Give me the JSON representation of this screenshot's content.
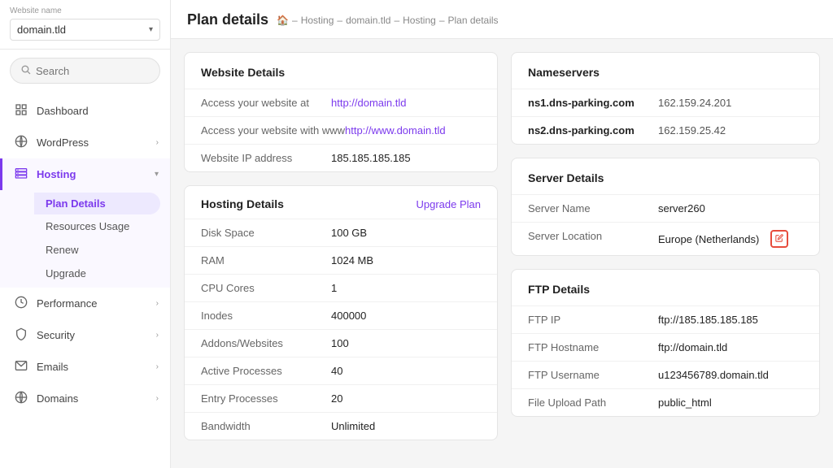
{
  "sidebar": {
    "website_name_label": "Website name",
    "website_name_value": "domain.tld",
    "search_placeholder": "Search",
    "nav_items": [
      {
        "id": "dashboard",
        "label": "Dashboard",
        "icon": "grid",
        "expanded": false
      },
      {
        "id": "wordpress",
        "label": "WordPress",
        "icon": "wp",
        "expanded": false
      },
      {
        "id": "hosting",
        "label": "Hosting",
        "icon": "hosting",
        "expanded": true,
        "sub_items": [
          {
            "id": "plan-details",
            "label": "Plan Details",
            "active": true
          },
          {
            "id": "resources-usage",
            "label": "Resources Usage",
            "active": false
          },
          {
            "id": "renew",
            "label": "Renew",
            "active": false
          },
          {
            "id": "upgrade",
            "label": "Upgrade",
            "active": false
          }
        ]
      },
      {
        "id": "performance",
        "label": "Performance",
        "icon": "performance",
        "expanded": false
      },
      {
        "id": "security",
        "label": "Security",
        "icon": "security",
        "expanded": false
      },
      {
        "id": "emails",
        "label": "Emails",
        "icon": "emails",
        "expanded": false
      },
      {
        "id": "domains",
        "label": "Domains",
        "icon": "domains",
        "expanded": false
      }
    ]
  },
  "page": {
    "title": "Plan details",
    "breadcrumb": [
      {
        "label": "🏠"
      },
      {
        "label": "Hosting"
      },
      {
        "label": "domain.tld"
      },
      {
        "label": "Hosting"
      },
      {
        "label": "Plan details"
      }
    ]
  },
  "website_details": {
    "section_title": "Website Details",
    "rows": [
      {
        "label": "Access your website at",
        "value": "http://domain.tld",
        "is_link": true
      },
      {
        "label": "Access your website with www",
        "value": "http://www.domain.tld",
        "is_link": true
      },
      {
        "label": "Website IP address",
        "value": "185.185.185.185",
        "is_link": false
      }
    ]
  },
  "hosting_details": {
    "section_title": "Hosting Details",
    "upgrade_label": "Upgrade Plan",
    "rows": [
      {
        "label": "Disk Space",
        "value": "100 GB"
      },
      {
        "label": "RAM",
        "value": "1024 MB"
      },
      {
        "label": "CPU Cores",
        "value": "1"
      },
      {
        "label": "Inodes",
        "value": "400000"
      },
      {
        "label": "Addons/Websites",
        "value": "100"
      },
      {
        "label": "Active Processes",
        "value": "40"
      },
      {
        "label": "Entry Processes",
        "value": "20"
      },
      {
        "label": "Bandwidth",
        "value": "Unlimited"
      }
    ]
  },
  "nameservers": {
    "section_title": "Nameservers",
    "rows": [
      {
        "label": "ns1.dns-parking.com",
        "value": "162.159.24.201"
      },
      {
        "label": "ns2.dns-parking.com",
        "value": "162.159.25.42"
      }
    ]
  },
  "server_details": {
    "section_title": "Server Details",
    "rows": [
      {
        "label": "Server Name",
        "value": "server260",
        "editable": false
      },
      {
        "label": "Server Location",
        "value": "Europe (Netherlands)",
        "editable": true
      }
    ]
  },
  "ftp_details": {
    "section_title": "FTP Details",
    "rows": [
      {
        "label": "FTP IP",
        "value": "ftp://185.185.185.185"
      },
      {
        "label": "FTP Hostname",
        "value": "ftp://domain.tld"
      },
      {
        "label": "FTP Username",
        "value": "u123456789.domain.tld"
      },
      {
        "label": "File Upload Path",
        "value": "public_html"
      }
    ]
  }
}
